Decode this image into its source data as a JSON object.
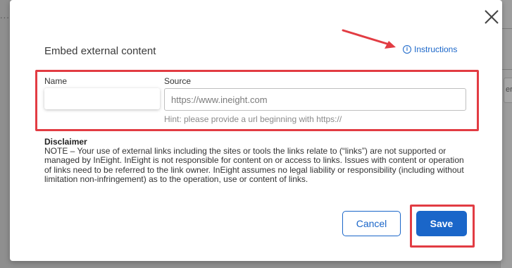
{
  "dialog": {
    "title": "Embed external content",
    "instructions_label": "Instructions",
    "name_label": "Name",
    "name_value": "",
    "source_label": "Source",
    "source_placeholder": "https://www.ineight.com",
    "hint": "Hint: please provide a url beginning with https://",
    "disclaimer_title": "Disclaimer",
    "disclaimer_text": "NOTE – Your use of external links including the sites or tools the links relate to (“links”) are not supported or managed by InEight. InEight is not responsible for content on or access to links. Issues with content or operation of links need to be referred to the link owner. InEight assumes no legal liability or responsibility (including without limitation non-infringement) as to the operation, use or content of links.",
    "cancel_label": "Cancel",
    "save_label": "Save"
  },
  "background": {
    "dots": "...",
    "side_chip_text": "ere"
  },
  "colors": {
    "accent": "#1a66c9",
    "highlight_red": "#e23c43",
    "overlay": "#8f8f8f"
  },
  "icons": {
    "close": "close-icon",
    "info": "info-icon",
    "annotation_arrow": "red-arrow-icon"
  }
}
